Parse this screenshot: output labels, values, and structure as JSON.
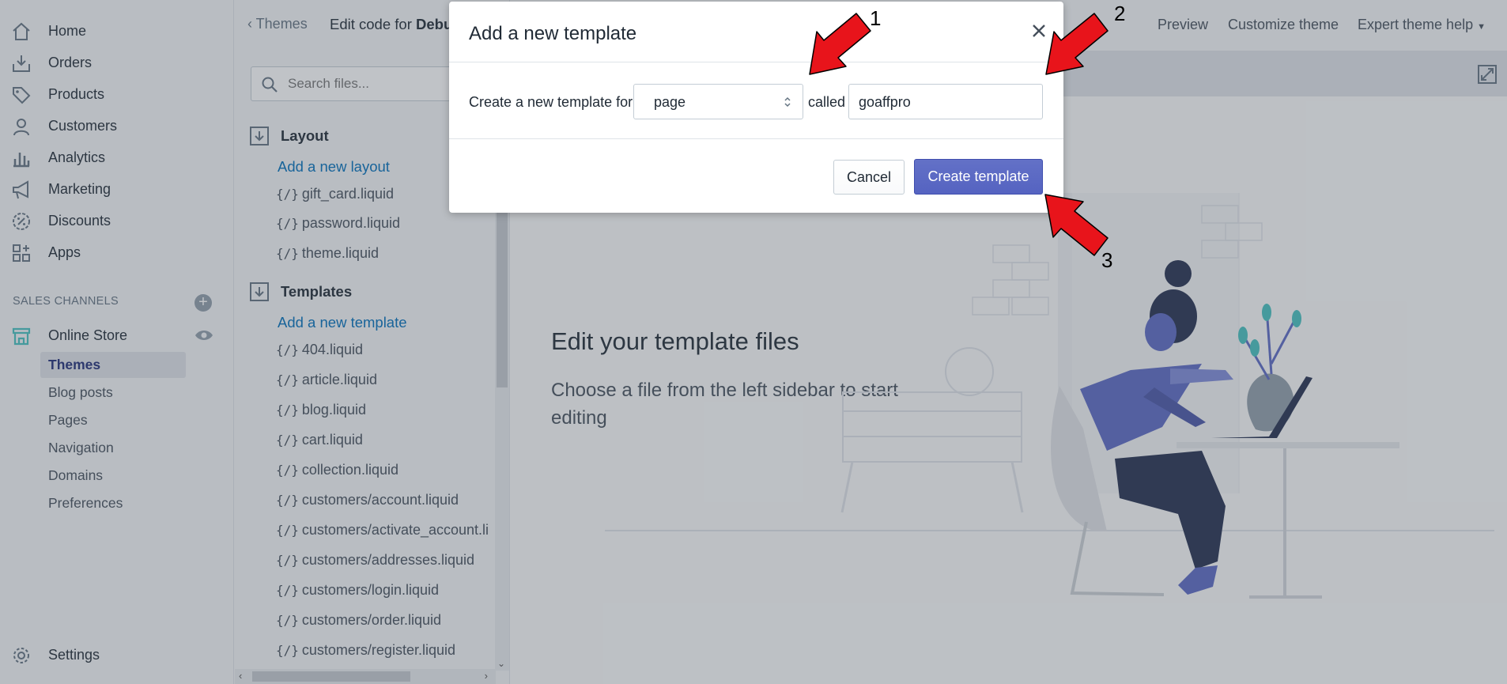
{
  "nav": {
    "items": [
      {
        "label": "Home",
        "icon": "home-icon"
      },
      {
        "label": "Orders",
        "icon": "orders-icon"
      },
      {
        "label": "Products",
        "icon": "tag-icon"
      },
      {
        "label": "Customers",
        "icon": "person-icon"
      },
      {
        "label": "Analytics",
        "icon": "bar-chart-icon"
      },
      {
        "label": "Marketing",
        "icon": "megaphone-icon"
      },
      {
        "label": "Discounts",
        "icon": "discount-icon"
      },
      {
        "label": "Apps",
        "icon": "apps-icon"
      }
    ],
    "sales_channels_heading": "SALES CHANNELS",
    "online_store": "Online Store",
    "sub_items": [
      "Themes",
      "Blog posts",
      "Pages",
      "Navigation",
      "Domains",
      "Preferences"
    ],
    "active_sub": "Themes",
    "settings": "Settings"
  },
  "editor": {
    "back_label": "Themes",
    "title_prefix": "Edit code for ",
    "theme_name": "Debu",
    "search_placeholder": "Search files...",
    "layout_folder": "Layout",
    "add_layout": "Add a new layout",
    "layout_files": [
      "gift_card.liquid",
      "password.liquid",
      "theme.liquid"
    ],
    "templates_folder": "Templates",
    "add_template": "Add a new template",
    "template_files": [
      "404.liquid",
      "article.liquid",
      "blog.liquid",
      "cart.liquid",
      "collection.liquid",
      "customers/account.liquid",
      "customers/activate_account.li",
      "customers/addresses.liquid",
      "customers/login.liquid",
      "customers/order.liquid",
      "customers/register.liquid"
    ],
    "file_icon_text": "{/}"
  },
  "topbar": {
    "preview": "Preview",
    "customize": "Customize theme",
    "help": "Expert theme help"
  },
  "empty_state": {
    "title": "Edit your template files",
    "subtitle": "Choose a file from the left sidebar to start editing"
  },
  "modal": {
    "title": "Add a new template",
    "label": "Create a new template for",
    "select_value": "page",
    "called": "called",
    "name_value": "goaffpro",
    "cancel": "Cancel",
    "create": "Create template"
  },
  "annotations": [
    "1",
    "2",
    "3"
  ],
  "colors": {
    "primary": "#5c6ac4",
    "link": "#006fbb",
    "arrow": "#e8141b",
    "active_nav": "#202e78"
  }
}
